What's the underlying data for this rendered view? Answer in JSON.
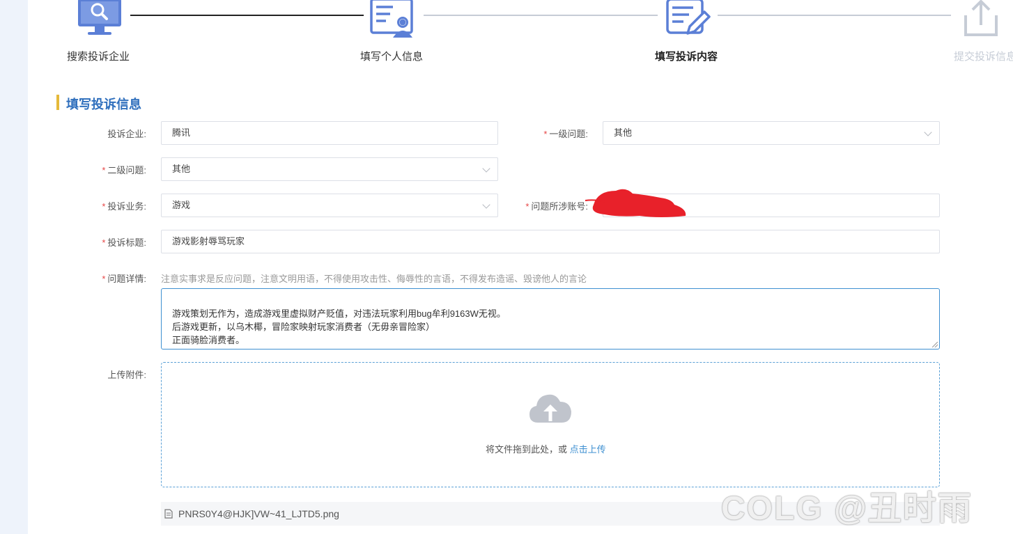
{
  "steps": [
    {
      "label": "搜索投诉企业",
      "icon": "monitor-search-icon",
      "state": "done"
    },
    {
      "label": "填写个人信息",
      "icon": "id-card-user-icon",
      "state": "done"
    },
    {
      "label": "填写投诉内容",
      "icon": "edit-document-icon",
      "state": "active"
    },
    {
      "label": "提交投诉信息",
      "icon": "upload-share-icon",
      "state": "pending"
    }
  ],
  "section": {
    "title": "填写投诉信息"
  },
  "form": {
    "company": {
      "label": "投诉企业:",
      "value": "腾讯"
    },
    "level1": {
      "label": "一级问题:",
      "value": "其他"
    },
    "level2": {
      "label": "二级问题:",
      "value": "其他"
    },
    "business": {
      "label": "投诉业务:",
      "value": "游戏"
    },
    "account": {
      "label": "问题所涉账号:",
      "value": ""
    },
    "title": {
      "label": "投诉标题:",
      "value": "游戏影射辱骂玩家"
    },
    "details": {
      "label": "问题详情:",
      "hint": "注意实事求是反应问题，注意文明用语，不得使用攻击性、侮辱性的言语，不得发布造谣、毁谤他人的言论",
      "value": "游戏策划无作为，造成游戏里虚拟财产贬值，对违法玩家利用bug牟利9163W无视。\n后游戏更新，以乌木椰，冒险家映射玩家消费者（无毋亲冒险家）\n正面骑脸消费者。"
    },
    "attachment": {
      "label": "上传附件:",
      "drop_text": "将文件拖到此处，或",
      "link_text": "点击上传",
      "file_name": "PNRS0Y4@HJK]VW~41_LJTD5.png"
    },
    "required_mark": "*"
  },
  "watermark": "COLG @丑时雨",
  "colors": {
    "primary": "#2f6fbd",
    "accent_bar": "#e5b93a",
    "required": "#e64545",
    "step_icon": "#5b7fd6",
    "step_inactive": "#c6ccd6"
  }
}
